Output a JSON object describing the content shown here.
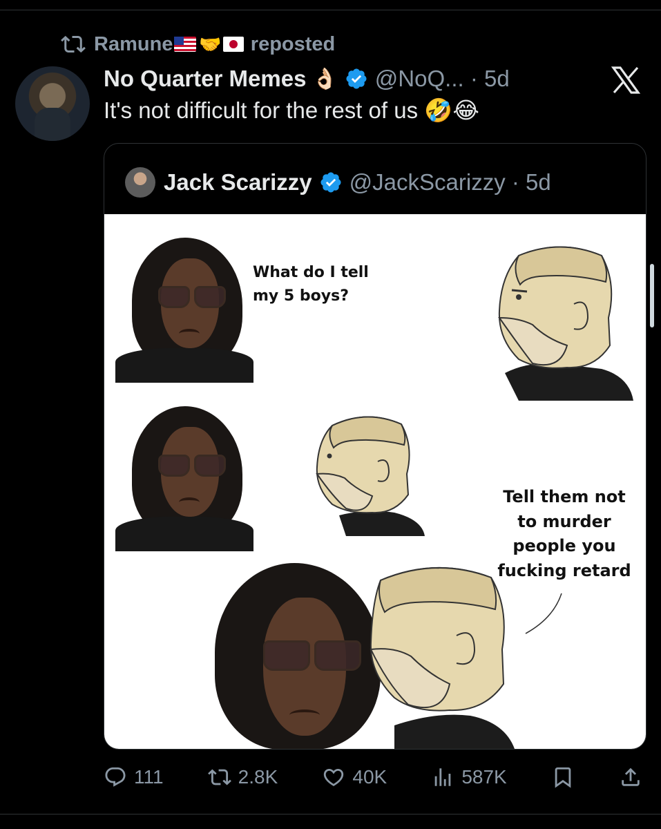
{
  "repost": {
    "user": "Ramune",
    "suffix": "reposted",
    "handshake": "🤝"
  },
  "post": {
    "display_name": "No Quarter Memes",
    "name_emoji": "👌🏻",
    "handle_meta": "@NoQ... · 5d",
    "text": "It's not difficult for the rest of us 🤣😂"
  },
  "quote": {
    "display_name": "Jack Scarizzy",
    "handle_meta": "@JackScarizzy · 5d",
    "meme_text_top": "What do I tell\nmy 5 boys?",
    "meme_text_bottom": "Tell them not\nto murder\npeople you\nfucking retard"
  },
  "actions": {
    "replies": "111",
    "reposts": "2.8K",
    "likes": "40K",
    "views": "587K"
  },
  "icons": {
    "repost": "repost-icon",
    "verified": "verified-badge-icon",
    "close": "x-close-icon",
    "reply": "reply-icon",
    "like": "like-icon",
    "views": "views-icon",
    "bookmark": "bookmark-icon",
    "share": "share-icon"
  },
  "colors": {
    "background": "#000000",
    "text": "#e7e9ea",
    "muted": "#8b98a5",
    "verified": "#1d9bf0"
  }
}
